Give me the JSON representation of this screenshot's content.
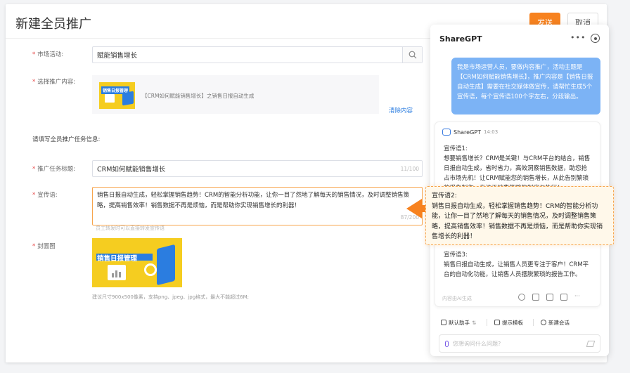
{
  "page": {
    "title": "新建全员推广",
    "send_label": "发送",
    "cancel_label": "取消"
  },
  "form": {
    "campaign_label": "市场活动:",
    "campaign_value": "赋能销售增长",
    "content_label": "选择推广内容:",
    "content_thumb_text": "销售日报管理",
    "content_text": "【CRM如何赋能销售增长】之销售日报自动生成",
    "clear_label": "清除内容",
    "section_title": "请填写全员推广任务信息:",
    "task_title_label": "推广任务标题:",
    "task_title_value": "CRM如何赋能销售增长",
    "task_title_counter": "11/100",
    "slogan_label": "宣传语:",
    "slogan_value": "销售日报自动生成，轻松掌握销售趋势！CRM的智能分析功能，让你一目了然地了解每天的销售情况，及时调整销售策略，提高销售效率！销售数据不再是烦恼，而是帮助你实现销售增长的利器！",
    "slogan_counter": "87/200",
    "slogan_hint": "员工转发时可以直接转发宣传语",
    "cover_label": "封面图",
    "cover_title": "销售日报管理",
    "cover_hint": "建议尺寸900x500像素，支持png、jpeg、jpg格式，最大不能超过6M;"
  },
  "panel": {
    "title": "ShareGPT",
    "more": "•••",
    "user_message": "我是市场运营人员，要做内容推广，活动主题是【CRM如何赋能销售增长】，推广内容是【销售日报自动生成】需要在社交媒体做宣传，请帮忙生成5个宣传语，每个宣传语100个字左右，分段输出。",
    "ai_name": "ShareGPT",
    "ai_time": "14:03",
    "s1_title": "宣传语1:",
    "s1_text": "想要销售增长？CRM是关键！与CRM平台的结合，销售日报自动生成，省时省力，高效洞察销售数据，助您抢占市场先机！让CRM赋能您的销售增长，从此告别繁琐的报告制作，专注于销售策略的制定与执行！",
    "s2_title": "宣传语2:",
    "s2_text": "销售日报自动生成，轻松掌握销售趋势！CRM的智能分析功能，让你一目了然地了解每天的销售情况，及时调整销售策略，提高销售效率！销售数据不再是烦恼，而是帮助你实现销售增长的利器！",
    "s3_title": "宣传语3:",
    "s3_text": "销售日报自动生成，让销售人员更专注于客户！CRM平台的自动化功能，让销售人员摆脱繁琐的报告工作。",
    "ai_footer": "内容由AI生成",
    "chip_assistant": "默认助手",
    "chip_template": "提示模板",
    "chip_new": "新建会话",
    "ask_placeholder": "您想询问什么问题?"
  },
  "colors": {
    "accent": "#f7821f",
    "user_bubble": "#7cb3f5",
    "link": "#2b7de0",
    "required": "#e64545"
  }
}
